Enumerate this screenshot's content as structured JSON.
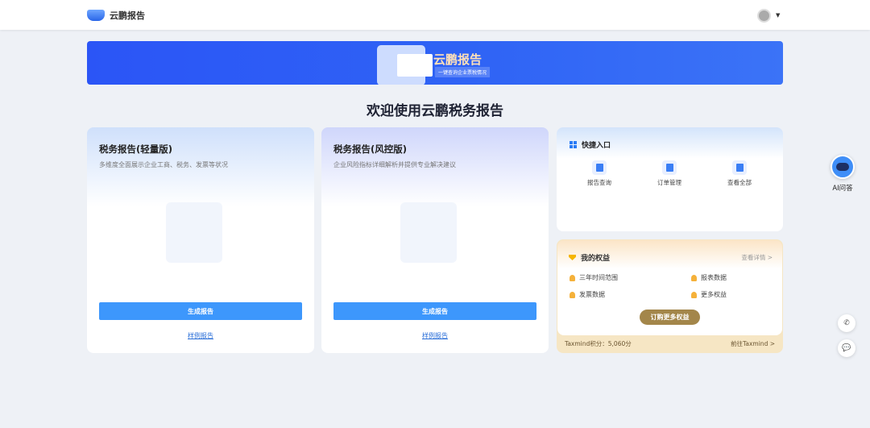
{
  "header": {
    "app_name": "云鹏报告"
  },
  "banner": {
    "title": "云鹏报告",
    "subtitle": "一键查询企业票税情况"
  },
  "welcome": "欢迎使用云鹏税务报告",
  "cards": [
    {
      "title": "税务报告(轻量版)",
      "desc": "多维度全面展示企业工商、税务、发票等状况",
      "generate": "生成报告",
      "sample": "样例报告"
    },
    {
      "title": "税务报告(风控版)",
      "desc": "企业风险指标详细解析并提供专业解决建议",
      "generate": "生成报告",
      "sample": "样例报告"
    }
  ],
  "quick": {
    "title": "快捷入口",
    "items": [
      {
        "label": "报告查询"
      },
      {
        "label": "订单管理"
      },
      {
        "label": "查看全部"
      }
    ]
  },
  "benefits": {
    "title": "我的权益",
    "detail": "查看详情 >",
    "items": [
      "三年时间范围",
      "报表数据",
      "发票数据",
      "更多权益"
    ],
    "buy": "订购更多权益",
    "points": "Taxmind积分：5,060分",
    "goto": "前往Taxmind >"
  },
  "float": {
    "ai_label": "AI问答"
  }
}
